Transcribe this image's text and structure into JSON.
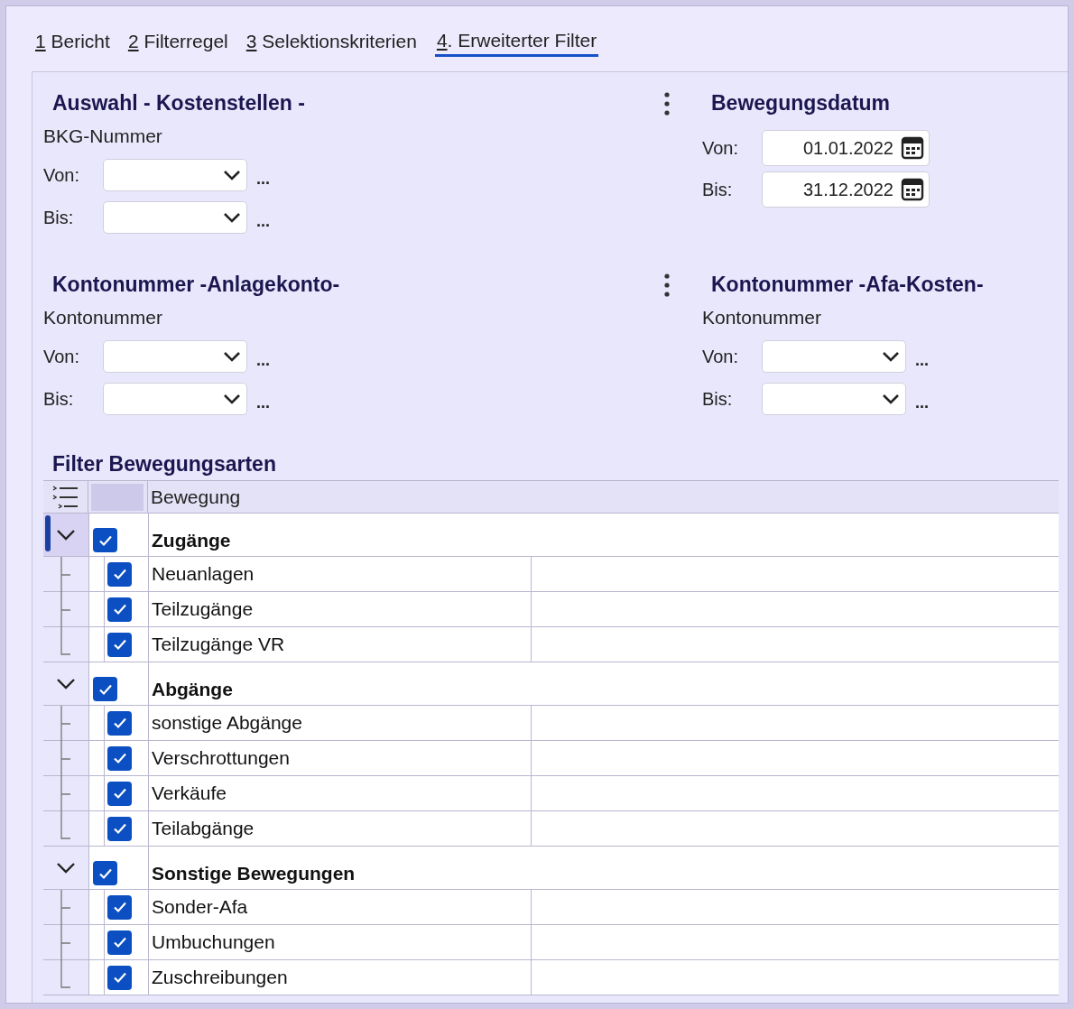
{
  "tabs": [
    {
      "key": "1",
      "rest": " Bericht",
      "selected": false
    },
    {
      "key": "2",
      "rest": " Filterregel",
      "selected": false
    },
    {
      "key": "3",
      "rest": " Selektionskriterien",
      "selected": false
    },
    {
      "key": "4",
      "rest": ". Erweiterter Filter",
      "selected": true
    }
  ],
  "sections": [
    {
      "kind": "range",
      "title": "Auswahl - Kostenstellen -",
      "menu": true,
      "subtitle": "BKG-Nummer",
      "fields": [
        {
          "label": "Von:",
          "browse": "..."
        },
        {
          "label": "Bis:",
          "browse": "..."
        }
      ]
    },
    {
      "kind": "date",
      "title": "Bewegungsdatum",
      "menu": false,
      "fields": [
        {
          "label": "Von:",
          "value": "01.01.2022"
        },
        {
          "label": "Bis:",
          "value": "31.12.2022"
        }
      ]
    },
    {
      "kind": "range",
      "title": "Kontonummer -Anlagekonto-",
      "menu": true,
      "subtitle": "Kontonummer",
      "fields": [
        {
          "label": "Von:",
          "browse": "..."
        },
        {
          "label": "Bis:",
          "browse": "..."
        }
      ]
    },
    {
      "kind": "range",
      "title": "Kontonummer -Afa-Kosten-",
      "menu": false,
      "subtitle": "Kontonummer",
      "fields": [
        {
          "label": "Von:",
          "browse": "..."
        },
        {
          "label": "Bis:",
          "browse": "..."
        }
      ]
    }
  ],
  "filter": {
    "title": "Filter Bewegungsarten",
    "column": "Bewegung",
    "groups": [
      {
        "label": "Zugänge",
        "checked": true,
        "expanded": true,
        "selected": true,
        "children": [
          {
            "label": "Neuanlagen",
            "checked": true
          },
          {
            "label": "Teilzugänge",
            "checked": true
          },
          {
            "label": "Teilzugänge VR",
            "checked": true
          }
        ]
      },
      {
        "label": "Abgänge",
        "checked": true,
        "expanded": true,
        "selected": false,
        "children": [
          {
            "label": "sonstige Abgänge",
            "checked": true
          },
          {
            "label": "Verschrottungen",
            "checked": true
          },
          {
            "label": "Verkäufe",
            "checked": true
          },
          {
            "label": "Teilabgänge",
            "checked": true
          }
        ]
      },
      {
        "label": "Sonstige Bewegungen",
        "checked": true,
        "expanded": true,
        "selected": false,
        "children": [
          {
            "label": "Sonder-Afa",
            "checked": true
          },
          {
            "label": "Umbuchungen",
            "checked": true
          },
          {
            "label": "Zuschreibungen",
            "checked": true
          }
        ]
      }
    ]
  }
}
